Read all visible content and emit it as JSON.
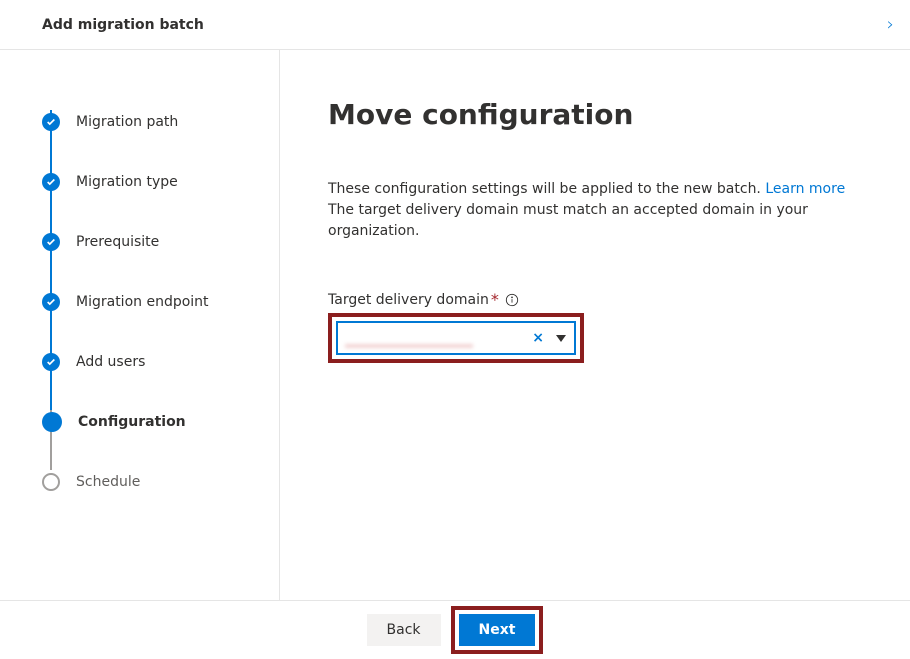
{
  "header": {
    "title": "Add migration batch"
  },
  "steps": {
    "items": [
      {
        "label": "Migration path"
      },
      {
        "label": "Migration type"
      },
      {
        "label": "Prerequisite"
      },
      {
        "label": "Migration endpoint"
      },
      {
        "label": "Add users"
      },
      {
        "label": "Configuration"
      },
      {
        "label": "Schedule"
      }
    ]
  },
  "content": {
    "title": "Move configuration",
    "desc1": "These configuration settings will be applied to the new batch. ",
    "learn_more": "Learn more",
    "desc2": "The target delivery domain must match an accepted domain in your organization."
  },
  "field": {
    "label": "Target delivery domain",
    "value": "",
    "clear": "×"
  },
  "footer": {
    "back": "Back",
    "next": "Next"
  }
}
